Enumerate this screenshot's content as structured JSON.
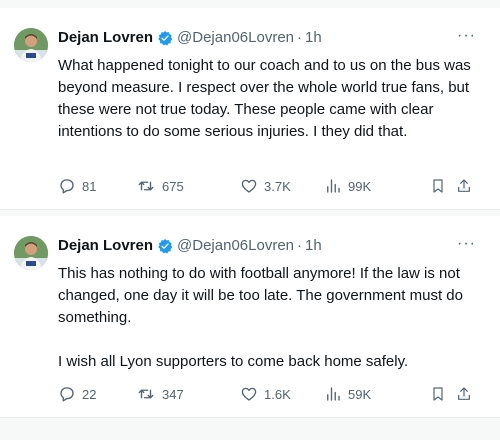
{
  "tweets": [
    {
      "author": "Dejan Lovren",
      "handle": "@Dejan06Lovren",
      "time": "1h",
      "separator": "·",
      "more": "···",
      "paragraphs": [
        "What happened tonight to our coach and to us on the bus was beyond measure. I respect over the whole world true fans, but these were not true today. These people came with clear intentions to do some serious injuries. I they did that."
      ],
      "replies": "81",
      "reposts": "675",
      "likes": "3.7K",
      "views": "99K"
    },
    {
      "author": "Dejan Lovren",
      "handle": "@Dejan06Lovren",
      "time": "1h",
      "separator": "·",
      "more": "···",
      "paragraphs": [
        "This has nothing to do with football anymore! If the law is not changed, one day it will be too late. The government must do something.",
        "I wish all Lyon supporters to come back home safely."
      ],
      "replies": "22",
      "reposts": "347",
      "likes": "1.6K",
      "views": "59K"
    }
  ],
  "colors": {
    "text": "#0f1419",
    "secondary": "#536471",
    "verified": "#1d9bf0",
    "divider": "#e6ecf0"
  },
  "icons": [
    "verified-badge-icon",
    "reply-icon",
    "repost-icon",
    "like-icon",
    "views-icon",
    "bookmark-icon",
    "share-icon",
    "more-icon"
  ]
}
